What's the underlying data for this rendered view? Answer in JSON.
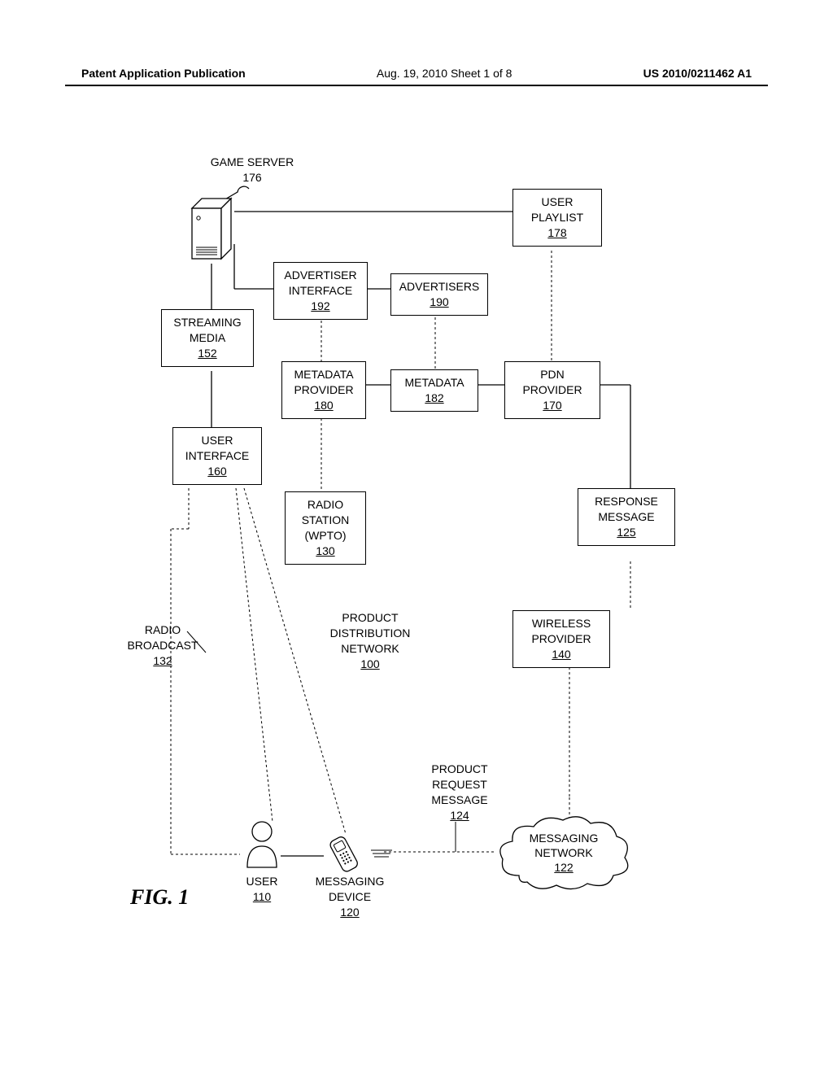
{
  "header": {
    "pub": "Patent Application Publication",
    "date_sheet": "Aug. 19, 2010  Sheet 1 of 8",
    "pubnum": "US 2010/0211462 A1"
  },
  "figure_label": "FIG. 1",
  "nodes": {
    "game_server": {
      "name": "GAME SERVER",
      "ref": "176"
    },
    "user_playlist": {
      "name": "USER\nPLAYLIST",
      "ref": "178"
    },
    "advertiser_interface": {
      "name": "ADVERTISER\nINTERFACE",
      "ref": "192"
    },
    "advertisers": {
      "name": "ADVERTISERS",
      "ref": "190"
    },
    "streaming_media": {
      "name": "STREAMING\nMEDIA",
      "ref": "152"
    },
    "metadata_provider": {
      "name": "METADATA\nPROVIDER",
      "ref": "180"
    },
    "metadata": {
      "name": "METADATA",
      "ref": "182"
    },
    "pdn_provider": {
      "name": "PDN\nPROVIDER",
      "ref": "170"
    },
    "user_interface": {
      "name": "USER\nINTERFACE",
      "ref": "160"
    },
    "radio_station": {
      "name": "RADIO\nSTATION\n(WPTO)",
      "ref": "130"
    },
    "response_message": {
      "name": "RESPONSE\nMESSAGE",
      "ref": "125"
    },
    "product_distribution_network": {
      "name": "PRODUCT\nDISTRIBUTION\nNETWORK",
      "ref": "100"
    },
    "wireless_provider": {
      "name": "WIRELESS\nPROVIDER",
      "ref": "140"
    },
    "radio_broadcast": {
      "name": "RADIO\nBROADCAST",
      "ref": "132"
    },
    "product_request_message": {
      "name": "PRODUCT\nREQUEST\nMESSAGE",
      "ref": "124"
    },
    "user": {
      "name": "USER",
      "ref": "110"
    },
    "messaging_device": {
      "name": "MESSAGING\nDEVICE",
      "ref": "120"
    },
    "messaging_network": {
      "name": "MESSAGING\nNETWORK",
      "ref": "122"
    }
  }
}
